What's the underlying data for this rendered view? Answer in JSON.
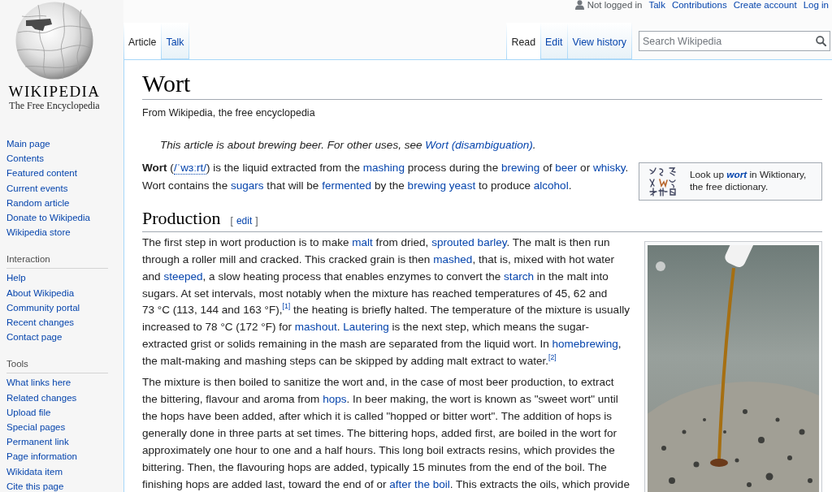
{
  "personal": {
    "status": "Not logged in",
    "links": [
      "Talk",
      "Contributions",
      "Create account",
      "Log in"
    ]
  },
  "logo": {
    "wordmark": "WIKIPEDIA",
    "tagline": "The Free Encyclopedia"
  },
  "sidebar": {
    "main": [
      "Main page",
      "Contents",
      "Featured content",
      "Current events",
      "Random article",
      "Donate to Wikipedia",
      "Wikipedia store"
    ],
    "sections": [
      {
        "heading": "Interaction",
        "items": [
          "Help",
          "About Wikipedia",
          "Community portal",
          "Recent changes",
          "Contact page"
        ]
      },
      {
        "heading": "Tools",
        "items": [
          "What links here",
          "Related changes",
          "Upload file",
          "Special pages",
          "Permanent link",
          "Page information",
          "Wikidata item",
          "Cite this page"
        ]
      }
    ]
  },
  "tabs_left": [
    {
      "label": "Article",
      "selected": true
    },
    {
      "label": "Talk",
      "selected": false
    }
  ],
  "tabs_right": [
    {
      "label": "Read",
      "selected": true
    },
    {
      "label": "Edit",
      "selected": false
    },
    {
      "label": "View history",
      "selected": false
    }
  ],
  "search": {
    "placeholder": "Search Wikipedia"
  },
  "article": {
    "title": "Wort",
    "subtitle": "From Wikipedia, the free encyclopedia",
    "hatnote": [
      {
        "kind": "text",
        "text": "This article is about brewing beer. For other uses, see "
      },
      {
        "kind": "link",
        "text": "Wort (disambiguation)"
      },
      {
        "kind": "text",
        "text": "."
      }
    ],
    "wiktionary": {
      "before": "Look up ",
      "term": "wort",
      "after": " in Wiktionary, the free dictionary."
    },
    "intro": [
      {
        "kind": "bold",
        "text": "Wort"
      },
      {
        "kind": "text",
        "text": " ("
      },
      {
        "kind": "ipa",
        "text": "/ˈwɜːrt/"
      },
      {
        "kind": "text",
        "text": ") is the liquid extracted from the "
      },
      {
        "kind": "link",
        "text": "mashing"
      },
      {
        "kind": "text",
        "text": " process during the "
      },
      {
        "kind": "link",
        "text": "brewing"
      },
      {
        "kind": "text",
        "text": " of "
      },
      {
        "kind": "link",
        "text": "beer"
      },
      {
        "kind": "text",
        "text": " or "
      },
      {
        "kind": "link",
        "text": "whisky"
      },
      {
        "kind": "text",
        "text": ". Wort contains the "
      },
      {
        "kind": "link",
        "text": "sugars"
      },
      {
        "kind": "text",
        "text": " that will be "
      },
      {
        "kind": "link",
        "text": "fermented"
      },
      {
        "kind": "text",
        "text": " by the "
      },
      {
        "kind": "link",
        "text": "brewing yeast"
      },
      {
        "kind": "text",
        "text": " to produce "
      },
      {
        "kind": "link",
        "text": "alcohol"
      },
      {
        "kind": "text",
        "text": "."
      }
    ],
    "sections": [
      {
        "heading": "Production",
        "edit": {
          "open": "[",
          "label": "edit",
          "close": "]"
        },
        "paragraphs": [
          [
            {
              "kind": "text",
              "text": "The first step in wort production is to make "
            },
            {
              "kind": "link",
              "text": "malt"
            },
            {
              "kind": "text",
              "text": " from dried, "
            },
            {
              "kind": "link",
              "text": "sprouted barley"
            },
            {
              "kind": "text",
              "text": ". The malt is then run through a roller mill and cracked. This cracked grain is then "
            },
            {
              "kind": "link",
              "text": "mashed"
            },
            {
              "kind": "text",
              "text": ", that is, mixed with hot water and "
            },
            {
              "kind": "link",
              "text": "steeped"
            },
            {
              "kind": "text",
              "text": ", a slow heating process that enables enzymes to convert the "
            },
            {
              "kind": "link",
              "text": "starch"
            },
            {
              "kind": "text",
              "text": " in the malt into sugars. At set intervals, most notably when the mixture has reached temperatures of 45, 62 and 73 °C (113, 144 and 163 °F),"
            },
            {
              "kind": "ref",
              "text": "[1]"
            },
            {
              "kind": "text",
              "text": " the heating is briefly halted. The temperature of the mixture is usually increased to 78 °C (172 °F) for "
            },
            {
              "kind": "link",
              "text": "mashout"
            },
            {
              "kind": "text",
              "text": ". "
            },
            {
              "kind": "link",
              "text": "Lautering"
            },
            {
              "kind": "text",
              "text": " is the next step, which means the sugar-extracted grist or solids remaining in the mash are separated from the liquid wort. In "
            },
            {
              "kind": "link",
              "text": "homebrewing"
            },
            {
              "kind": "text",
              "text": ", the malt-making and mashing steps can be skipped by adding malt extract to water."
            },
            {
              "kind": "ref",
              "text": "[2]"
            }
          ],
          [
            {
              "kind": "text",
              "text": "The mixture is then boiled to sanitize the wort and, in the case of most beer production, to extract the bittering, flavour and aroma from "
            },
            {
              "kind": "link",
              "text": "hops"
            },
            {
              "kind": "text",
              "text": ". In beer making, the wort is known as \"sweet wort\" until the hops have been added, after which it is called \"hopped or bitter wort\". The addition of hops is generally done in three parts at set times. The bittering hops, added first, are boiled in the wort for approximately one hour to one and a half hours. This long boil extracts resins, which provides the bittering. Then, the flavouring hops are added, typically 15 minutes from the end of the boil. The finishing hops are added last, toward the end of or "
            },
            {
              "kind": "link",
              "text": "after the boil"
            },
            {
              "kind": "text",
              "text": ". This extracts the oils, which provide"
            }
          ]
        ]
      }
    ]
  }
}
